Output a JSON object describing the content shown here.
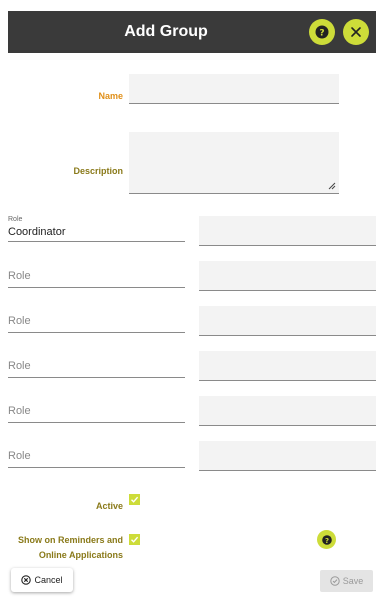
{
  "header": {
    "title": "Add Group"
  },
  "form": {
    "name_label": "Name",
    "name_value": "",
    "description_label": "Description",
    "description_value": "",
    "roles": [
      {
        "label": "Role",
        "value": "Coordinator",
        "side_value": ""
      },
      {
        "label": "Role",
        "value": "",
        "side_value": ""
      },
      {
        "label": "Role",
        "value": "",
        "side_value": ""
      },
      {
        "label": "Role",
        "value": "",
        "side_value": ""
      },
      {
        "label": "Role",
        "value": "",
        "side_value": ""
      },
      {
        "label": "Role",
        "value": "",
        "side_value": ""
      }
    ],
    "active_label": "Active",
    "active_checked": true,
    "show_reminders_label_line1": "Show on Reminders and",
    "show_reminders_label_line2": "Online Applications",
    "show_reminders_checked": true
  },
  "footer": {
    "cancel_label": "Cancel",
    "save_label": "Save"
  },
  "colors": {
    "accent": "#cddc39",
    "header_bg": "#3a3a3a",
    "label_orange": "#e0901a",
    "label_olive": "#8a7a1a"
  },
  "icons": {
    "help": "question-circle-icon",
    "close": "close-icon",
    "check": "check-icon",
    "cancel": "cancel-circle-icon",
    "save": "check-circle-icon"
  }
}
